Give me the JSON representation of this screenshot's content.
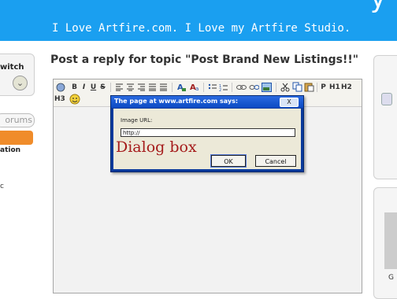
{
  "banner": {
    "partial_title": "y",
    "tagline": "I Love Artfire.com. I Love my Artfire Studio."
  },
  "left_sidebar": {
    "switch_label": "witch",
    "forums_tab": "orums",
    "orange_label": "ation",
    "fragment": "c"
  },
  "post": {
    "title": "Post a reply for topic \"Post Brand New Listings!!\""
  },
  "toolbar": {
    "buttons_row1": [
      "B",
      "I",
      "U",
      "S",
      "P",
      "H1",
      "H2"
    ],
    "buttons_row2": [
      "H3"
    ]
  },
  "dialog": {
    "title": "The page at www.artfire.com says:",
    "close": "X",
    "prompt_label": "Image URL:",
    "input_value": "http://",
    "overlay_text": "Dialog box",
    "ok_label": "OK",
    "cancel_label": "Cancel"
  },
  "right_sidebar": {
    "fragment": "G"
  },
  "colors": {
    "banner": "#1a9ff0",
    "dialog_frame": "#0a3a9c",
    "dialog_body": "#ece9d8",
    "overlay_text": "#a51b1b",
    "orange": "#f08c2a"
  },
  "icons": {
    "toolbar": [
      "bbcode-icon",
      "bold-icon",
      "italic-icon",
      "underline-icon",
      "strike-icon",
      "align-left-icon",
      "align-center-icon",
      "align-right-icon",
      "justify-icon",
      "text-color-icon",
      "font-size-icon",
      "bullet-list-icon",
      "numbered-list-icon",
      "link-icon",
      "unlink-icon",
      "image-icon",
      "cut-icon",
      "copy-icon",
      "paste-icon",
      "emoticon-icon"
    ]
  }
}
